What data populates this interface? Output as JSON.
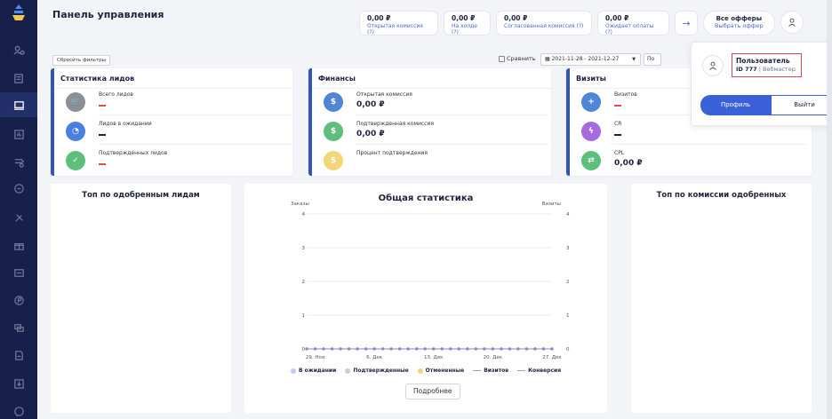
{
  "page": {
    "title": "Панель управления"
  },
  "topbar": {
    "stats": [
      {
        "value": "0,00 ₽",
        "label": "Открытая комиссия (?)"
      },
      {
        "value": "0,00 ₽",
        "label": "На холде (?)"
      },
      {
        "value": "0,00 ₽",
        "label": "Согласованная комиссия (?)"
      },
      {
        "value": "0,00 ₽",
        "label": "Ожидает оплаты (?)"
      }
    ],
    "arrow": "→",
    "offers_title": "Все офферы",
    "offers_link": "Выбрать оффер"
  },
  "filters": {
    "reset": "Сбросить фильтры",
    "compare": "Сравнить",
    "date_range": "2021-11-28 - 2021-12-27",
    "period": "По"
  },
  "leads": {
    "title": "Статистика лидов",
    "rows": [
      {
        "label": "Всего лидов",
        "icon": "cart-icon"
      },
      {
        "label": "Лидов в ожидании",
        "icon": "clock-icon"
      },
      {
        "label": "Подтвержденных лидов",
        "icon": "check-icon"
      }
    ]
  },
  "finance": {
    "title": "Финансы",
    "rows": [
      {
        "label": "Открытая комиссия",
        "value": "0,00 ₽",
        "icon": "dollar-icon"
      },
      {
        "label": "Подтвержденная комиссия",
        "value": "0,00 ₽",
        "icon": "dollar-icon"
      },
      {
        "label": "Процент подтверждения",
        "value": "",
        "icon": "dollar-icon"
      }
    ]
  },
  "visits": {
    "title": "Визиты",
    "rows": [
      {
        "label": "Визитов",
        "icon": "user-plus-icon"
      },
      {
        "label": "CR",
        "icon": "bolt-icon"
      },
      {
        "label": "CPL",
        "value": "0,00 ₽",
        "icon": "shuffle-icon"
      }
    ]
  },
  "panels": {
    "top_approved": "Топ по одобренным лидам",
    "top_commission": "Топ по комиссии одобренных"
  },
  "chart_data": {
    "type": "line",
    "title": "Общая статистика",
    "ylabel": "Заказы",
    "y2label": "Визиты",
    "ylim": [
      0,
      4
    ],
    "yticks": [
      "0",
      "1",
      "2",
      "3",
      "4"
    ],
    "xtick_labels": [
      "29. Ноя",
      "6. Дек",
      "13. Дек",
      "20. Дек",
      "27. Дек"
    ],
    "x": [
      "2021-11-28",
      "2021-11-29",
      "2021-11-30",
      "2021-12-01",
      "2021-12-02",
      "2021-12-03",
      "2021-12-04",
      "2021-12-05",
      "2021-12-06",
      "2021-12-07",
      "2021-12-08",
      "2021-12-09",
      "2021-12-10",
      "2021-12-11",
      "2021-12-12",
      "2021-12-13",
      "2021-12-14",
      "2021-12-15",
      "2021-12-16",
      "2021-12-17",
      "2021-12-18",
      "2021-12-19",
      "2021-12-20",
      "2021-12-21",
      "2021-12-22",
      "2021-12-23",
      "2021-12-24",
      "2021-12-25",
      "2021-12-26",
      "2021-12-27"
    ],
    "series": [
      {
        "name": "В ожидании",
        "color": "#c4cdf0",
        "values": [
          0,
          0,
          0,
          0,
          0,
          0,
          0,
          0,
          0,
          0,
          0,
          0,
          0,
          0,
          0,
          0,
          0,
          0,
          0,
          0,
          0,
          0,
          0,
          0,
          0,
          0,
          0,
          0,
          0,
          0
        ]
      },
      {
        "name": "Подтвержденные",
        "color": "#c8cdd6",
        "values": [
          0,
          0,
          0,
          0,
          0,
          0,
          0,
          0,
          0,
          0,
          0,
          0,
          0,
          0,
          0,
          0,
          0,
          0,
          0,
          0,
          0,
          0,
          0,
          0,
          0,
          0,
          0,
          0,
          0,
          0
        ]
      },
      {
        "name": "Отмененные",
        "color": "#f3d67c",
        "values": [
          0,
          0,
          0,
          0,
          0,
          0,
          0,
          0,
          0,
          0,
          0,
          0,
          0,
          0,
          0,
          0,
          0,
          0,
          0,
          0,
          0,
          0,
          0,
          0,
          0,
          0,
          0,
          0,
          0,
          0
        ]
      },
      {
        "name": "Визитов",
        "color": "#b0b5c8",
        "values": [
          0,
          0,
          0,
          0,
          0,
          0,
          0,
          0,
          0,
          0,
          0,
          0,
          0,
          0,
          0,
          0,
          0,
          0,
          0,
          0,
          0,
          0,
          0,
          0,
          0,
          0,
          0,
          0,
          0,
          0
        ]
      },
      {
        "name": "Конверсия",
        "color": "#8f86c9",
        "values": [
          0,
          0,
          0,
          0,
          0,
          0,
          0,
          0,
          0,
          0,
          0,
          0,
          0,
          0,
          0,
          0,
          0,
          0,
          0,
          0,
          0,
          0,
          0,
          0,
          0,
          0,
          0,
          0,
          0,
          0
        ]
      }
    ],
    "grid": true,
    "legend": "bottom"
  },
  "chart": {
    "details": "Подробнее"
  },
  "user": {
    "name": "Пользователь",
    "id": "ID 777",
    "role": "Вебмастер",
    "profile": "Профиль",
    "logout": "Выйти"
  },
  "colors": {
    "sidebar": "#16204a",
    "accent": "#3a61d8",
    "bar": "#3057b8"
  }
}
